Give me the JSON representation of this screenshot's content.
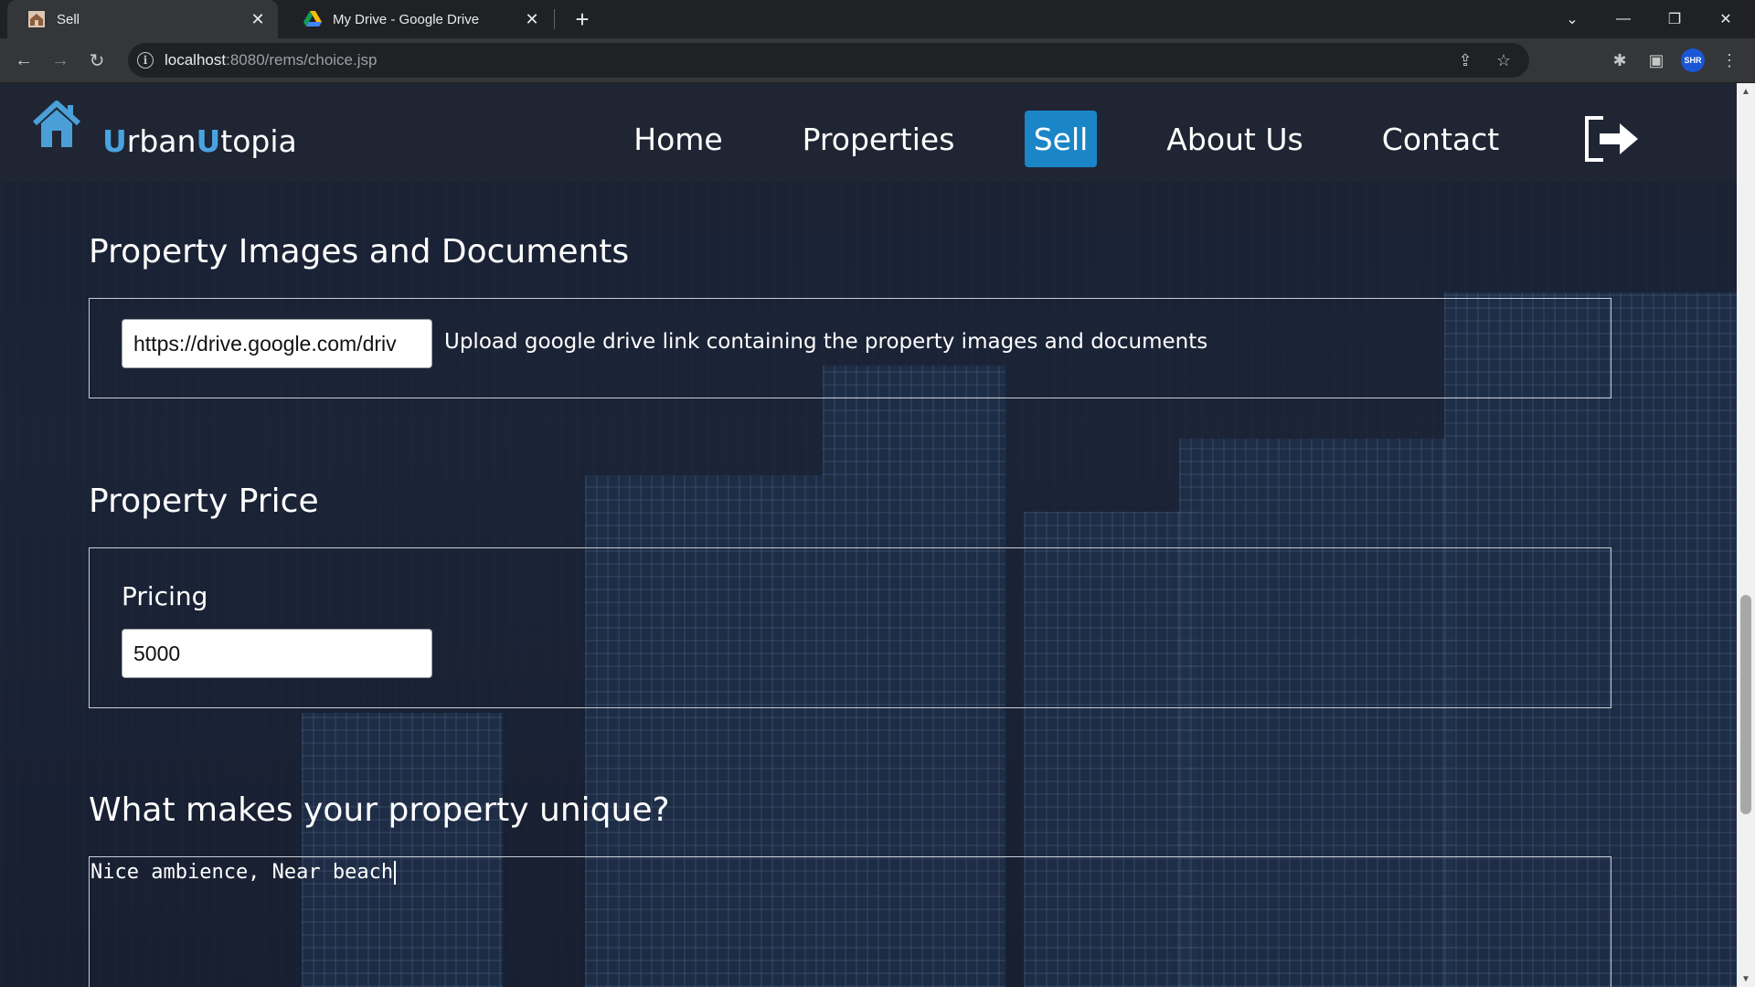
{
  "browser": {
    "tabs": [
      {
        "title": "Sell",
        "active": true
      },
      {
        "title": "My Drive - Google Drive",
        "active": false
      }
    ],
    "url_host": "localhost",
    "url_rest": ":8080/rems/choice.jsp",
    "profile_label": "SHR"
  },
  "site": {
    "brand_u1": "U",
    "brand_rest1": "rban",
    "brand_u2": "U",
    "brand_rest2": "topia",
    "nav": [
      {
        "label": "Home",
        "active": false
      },
      {
        "label": "Properties",
        "active": false
      },
      {
        "label": "Sell",
        "active": true
      },
      {
        "label": "About Us",
        "active": false
      },
      {
        "label": "Contact",
        "active": false
      }
    ],
    "accent_color": "#1a86c7"
  },
  "images_section": {
    "title": "Property Images and Documents",
    "drive_link_value": "https://drive.google.com/driv",
    "help_text": "Upload google drive link containing the property images and documents"
  },
  "price_section": {
    "title": "Property Price",
    "pricing_label": "Pricing",
    "pricing_value": "5000"
  },
  "unique_section": {
    "title": "What makes your property unique?",
    "text_value": "Nice ambience, Near beach"
  }
}
